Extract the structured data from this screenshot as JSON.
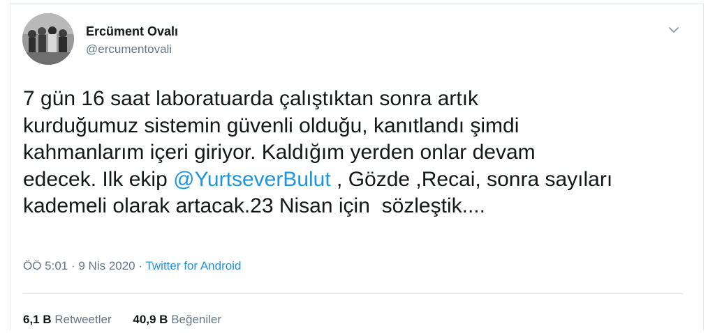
{
  "user": {
    "display_name": "Ercüment Ovalı",
    "handle": "@ercumentovali"
  },
  "tweet": {
    "lines": [
      "7 gün 16 saat laboratuarda çalıştıktan sonra artık",
      "kurduğumuz sistemin güvenli olduğu, kanıtlandı şimdi",
      "kahmanlarım içeri giriyor. Kaldığım yerden onlar devam"
    ],
    "line4_before": "edecek. Ilk ekip ",
    "mention": "@YurtseverBulut",
    "line4_after": " , Gözde ,Recai, sonra sayıları",
    "line5": "kademeli olarak artacak.23 Nisan için  sözleştik...."
  },
  "meta": {
    "time_date": "ÖÖ 5:01 · 9 Nis 2020 · ",
    "source": "Twitter for Android"
  },
  "stats": {
    "retweets_count": "6,1 B",
    "retweets_label": "Retweetler",
    "likes_count": "40,9 B",
    "likes_label": "Beğeniler"
  },
  "icons": {
    "menu": "chevron-down-icon",
    "avatar": "profile-photo"
  },
  "colors": {
    "link": "#1b95e0",
    "secondary_text": "#657786",
    "primary_text": "#14171a",
    "divider": "#e6ecf0"
  }
}
